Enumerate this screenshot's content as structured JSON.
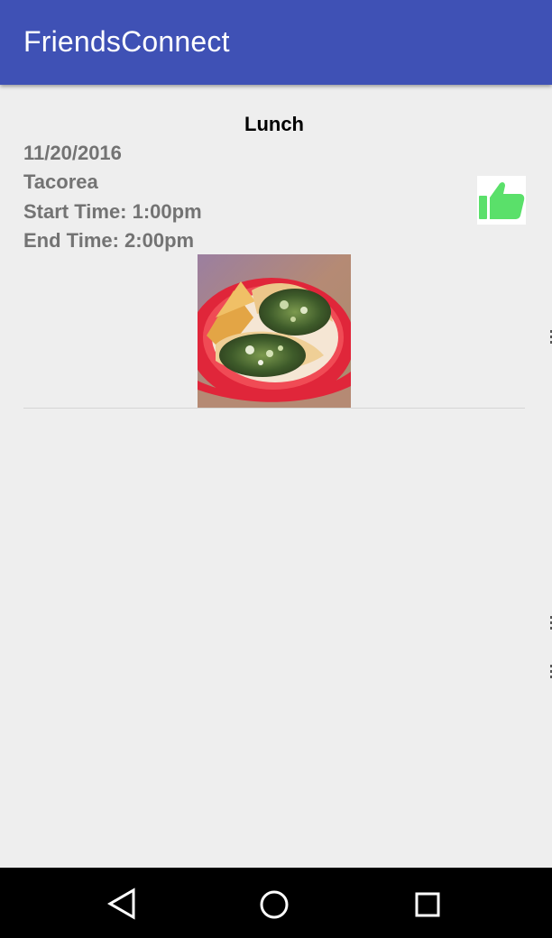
{
  "app_bar": {
    "title": "FriendsConnect",
    "color": "#3f51b5"
  },
  "event": {
    "title": "Lunch",
    "date": "11/20/2016",
    "place": "Tacorea",
    "start_time": "Start Time: 1:00pm",
    "end_time": "End Time: 2:00pm",
    "like_icon": "thumbs-up-icon",
    "like_color": "#5ae06a",
    "photo": "tacos-photo"
  },
  "nav_bar": {
    "back_icon": "back-triangle-icon",
    "home_icon": "home-circle-icon",
    "recents_icon": "recents-square-icon"
  }
}
